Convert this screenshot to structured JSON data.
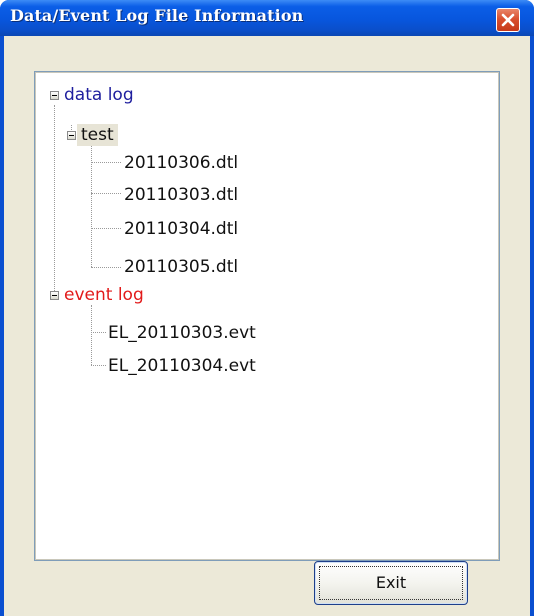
{
  "window": {
    "title": "Data/Event Log File Information"
  },
  "tree": {
    "root_nodes": [
      {
        "label": "data log",
        "children": [
          {
            "label": "test",
            "children": [
              {
                "label": "20110306.dtl"
              },
              {
                "label": "20110303.dtl"
              },
              {
                "label": "20110304.dtl"
              },
              {
                "label": "20110305.dtl"
              }
            ]
          }
        ]
      },
      {
        "label": "event log",
        "children": [
          {
            "label": "EL_20110303.evt"
          },
          {
            "label": "EL_20110304.evt"
          }
        ]
      }
    ]
  },
  "buttons": {
    "exit_label": "Exit"
  },
  "colors": {
    "data_log": "#1e1e9e",
    "event_log": "#e21a1a",
    "titlebar": "#0856dd",
    "client_bg": "#ece9d8"
  }
}
